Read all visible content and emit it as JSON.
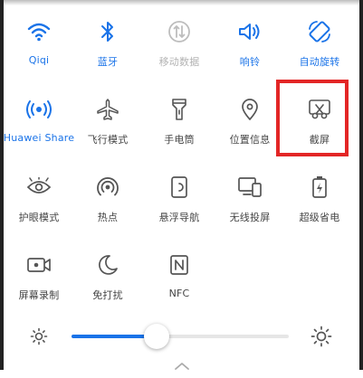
{
  "accent_color": "#1a73e8",
  "highlight_color": "#e32626",
  "tiles": [
    {
      "label": "Qiqi",
      "icon": "wifi-icon",
      "state": "active"
    },
    {
      "label": "蓝牙",
      "icon": "bluetooth-icon",
      "state": "active"
    },
    {
      "label": "移动数据",
      "icon": "mobile-data-icon",
      "state": "disabled"
    },
    {
      "label": "响铃",
      "icon": "ring-volume-icon",
      "state": "active"
    },
    {
      "label": "自动旋转",
      "icon": "auto-rotate-icon",
      "state": "active"
    },
    {
      "label": "Huawei Share",
      "icon": "huawei-share-icon",
      "state": "active"
    },
    {
      "label": "飞行模式",
      "icon": "airplane-icon",
      "state": "off"
    },
    {
      "label": "手电筒",
      "icon": "flashlight-icon",
      "state": "off"
    },
    {
      "label": "位置信息",
      "icon": "location-icon",
      "state": "off"
    },
    {
      "label": "截屏",
      "icon": "screenshot-icon",
      "state": "off"
    },
    {
      "label": "护眼模式",
      "icon": "eye-comfort-icon",
      "state": "off"
    },
    {
      "label": "热点",
      "icon": "hotspot-icon",
      "state": "off"
    },
    {
      "label": "悬浮导航",
      "icon": "floating-dock-icon",
      "state": "off"
    },
    {
      "label": "无线投屏",
      "icon": "wireless-projection-icon",
      "state": "off"
    },
    {
      "label": "超级省电",
      "icon": "ultra-power-saving-icon",
      "state": "off"
    },
    {
      "label": "屏幕录制",
      "icon": "screen-recorder-icon",
      "state": "off"
    },
    {
      "label": "免打扰",
      "icon": "do-not-disturb-icon",
      "state": "off"
    },
    {
      "label": "NFC",
      "icon": "nfc-icon",
      "state": "off"
    }
  ],
  "brightness": {
    "level": 0.39,
    "min_icon": "brightness-low-icon",
    "max_icon": "brightness-high-icon"
  }
}
